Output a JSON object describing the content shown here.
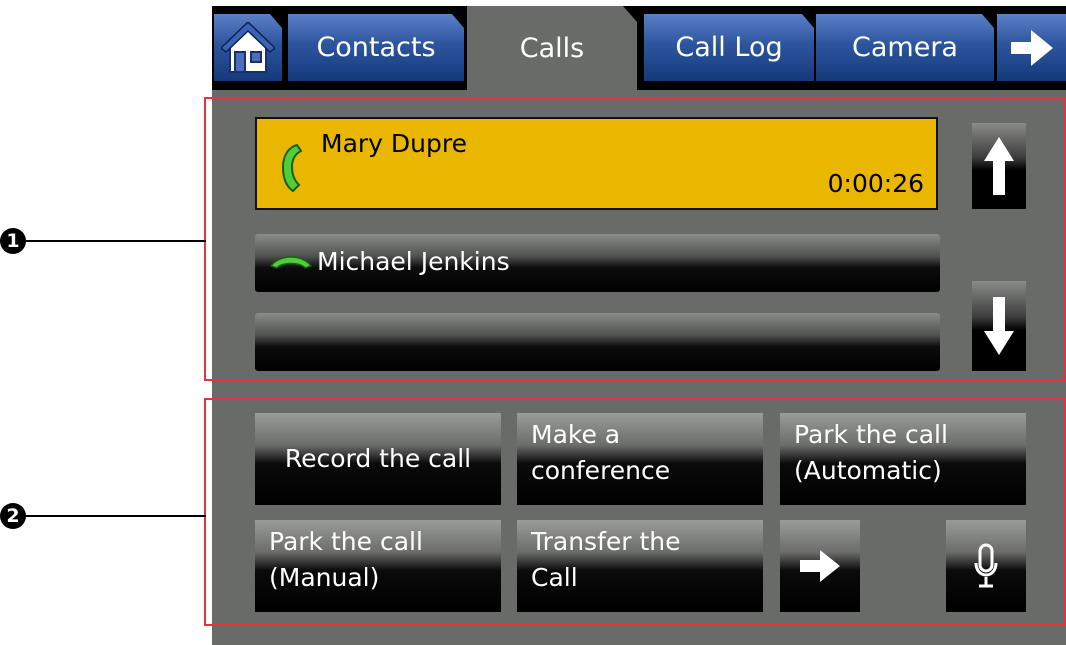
{
  "tabs": [
    {
      "id": "home",
      "icon": "home-icon"
    },
    {
      "id": "contacts",
      "label": "Contacts"
    },
    {
      "id": "calls",
      "label": "Calls",
      "active": true
    },
    {
      "id": "call-log",
      "label": "Call Log"
    },
    {
      "id": "camera",
      "label": "Camera"
    },
    {
      "id": "more",
      "icon": "arrow-right-icon"
    }
  ],
  "calls": {
    "active": {
      "name": "Mary Dupre",
      "duration": "0:00:26",
      "icon": "phone-active-icon"
    },
    "held": {
      "name": "Michael Jenkins",
      "icon": "phone-hangup-icon"
    },
    "empty_slot": ""
  },
  "scroll": {
    "up_icon": "arrow-up-icon",
    "down_icon": "arrow-down-icon"
  },
  "actions": {
    "record": {
      "line1": "Record the call"
    },
    "conference": {
      "line1": "Make a",
      "line2": "conference"
    },
    "park_auto": {
      "line1": "Park the call",
      "line2": "(Automatic)"
    },
    "park_manual": {
      "line1": "Park the call",
      "line2": "(Manual)"
    },
    "transfer": {
      "line1": "Transfer the",
      "line2": "Call"
    },
    "next_icon": "arrow-right-icon",
    "mic_icon": "microphone-icon"
  },
  "callouts": {
    "one": "1",
    "two": "2"
  },
  "colors": {
    "active_call": "#e9b700",
    "tab_blue": "#2d559e",
    "panel": "#696b68",
    "annotation": "#e3343d"
  }
}
